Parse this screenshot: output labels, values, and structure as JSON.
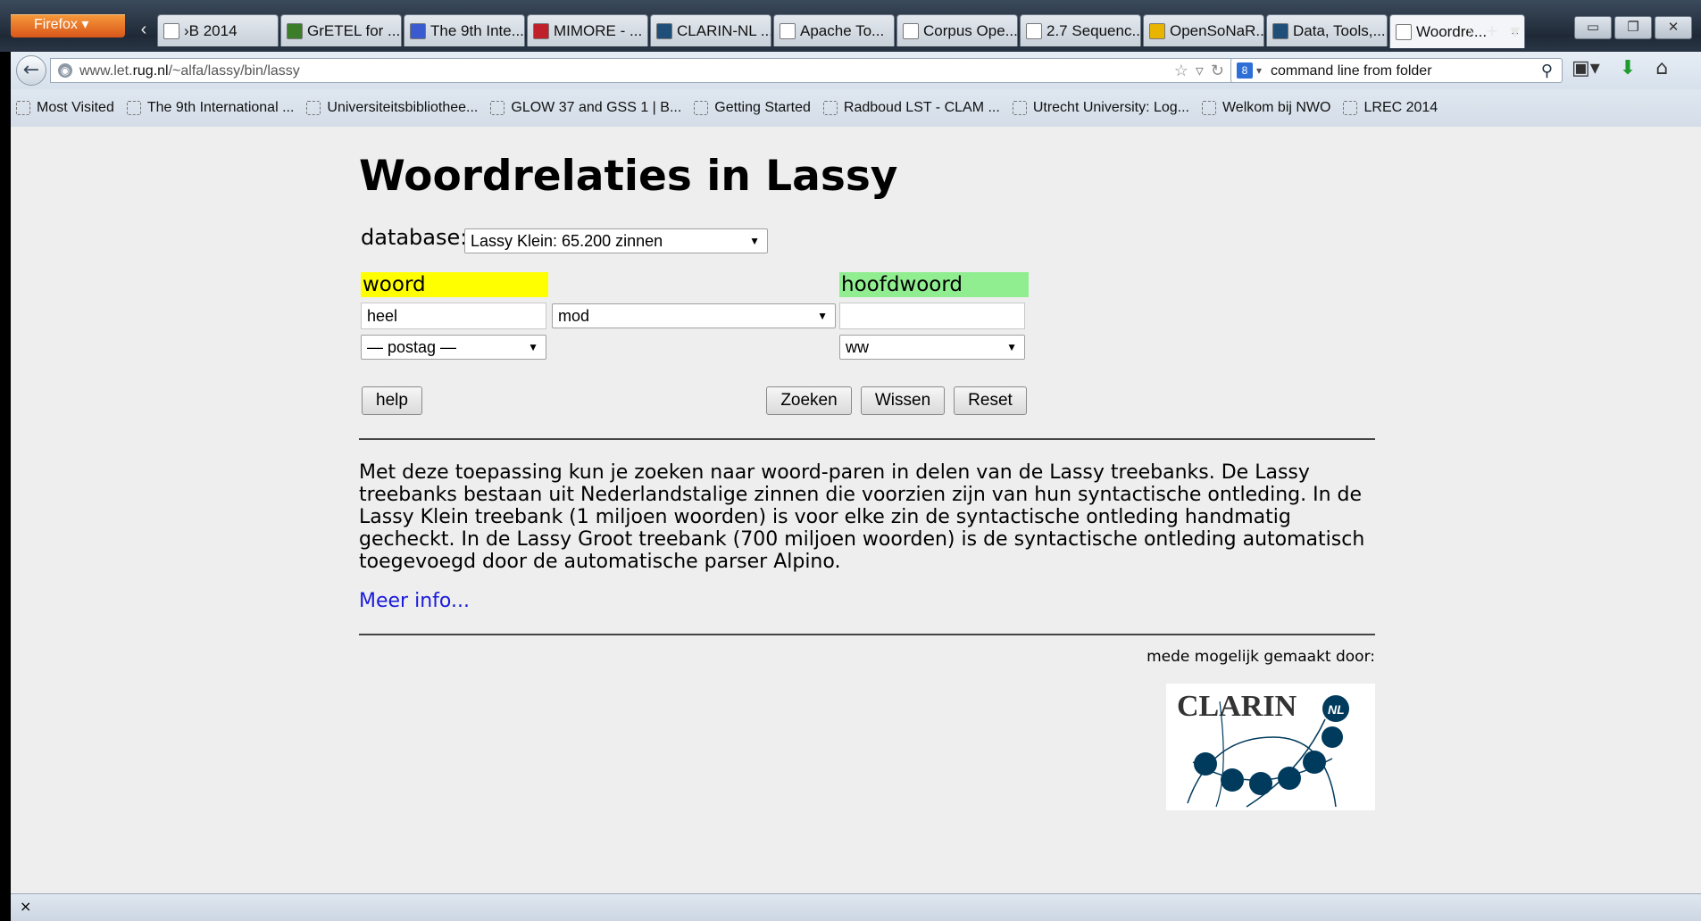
{
  "browser": {
    "menu_label": "Firefox",
    "tabs": [
      {
        "label": "›B 2014",
        "icon": "page-icon"
      },
      {
        "label": "GrETEL for ...",
        "icon": "tree-icon"
      },
      {
        "label": "The 9th Inte...",
        "icon": "s-logo-icon"
      },
      {
        "label": "MIMORE - ...",
        "icon": "bars-icon"
      },
      {
        "label": "CLARIN-NL ...",
        "icon": "clarin-icon"
      },
      {
        "label": "Apache To...",
        "icon": "page-icon"
      },
      {
        "label": "Corpus Ope...",
        "icon": "page-icon"
      },
      {
        "label": "2.7 Sequenc...",
        "icon": "page-icon"
      },
      {
        "label": "OpenSoNaR...",
        "icon": "sun-icon"
      },
      {
        "label": "Data, Tools,...",
        "icon": "clarin-icon"
      },
      {
        "label": "Woordre...",
        "icon": "page-icon",
        "active": true
      }
    ],
    "tab_close": "×",
    "url_domain": "www.let.",
    "url_host": "rug.nl",
    "url_path": "/~alfa/lassy/bin/lassy",
    "search_value": "command line from folder",
    "bookmarks": [
      {
        "label": "Most Visited"
      },
      {
        "label": "The 9th International ..."
      },
      {
        "label": "Universiteitsbibliothee..."
      },
      {
        "label": "GLOW 37 and GSS 1 | B..."
      },
      {
        "label": "Getting Started"
      },
      {
        "label": "Radboud LST - CLAM ..."
      },
      {
        "label": "Utrecht University: Log..."
      },
      {
        "label": "Welkom bij NWO"
      },
      {
        "label": "LREC 2014"
      }
    ],
    "status_text": "×"
  },
  "page": {
    "title": "Woordrelaties in Lassy",
    "database_label": "database:",
    "database_value": "Lassy Klein: 65.200 zinnen",
    "woord_label": "woord",
    "hoofdwoord_label": "hoofdwoord",
    "woord_value": "heel",
    "relation_value": "mod",
    "hoofdwoord_value": "",
    "woord_postag": "— postag —",
    "hoofdwoord_postag": "ww",
    "buttons": {
      "help": "help",
      "search": "Zoeken",
      "clear": "Wissen",
      "reset": "Reset"
    },
    "description": "Met deze toepassing kun je zoeken naar woord-paren in delen van de Lassy treebanks. De Lassy treebanks bestaan uit Nederlandstalige zinnen die voorzien zijn van hun syntactische ontleding. In de Lassy Klein treebank (1 miljoen woorden) is voor elke zin de syntactische ontleding handmatig gecheckt. In de Lassy Groot treebank (700 miljoen woorden) is de syntactische ontleding automatisch toegevoegd door de automatische parser Alpino.",
    "more_info": "Meer info...",
    "credit": "mede mogelijk gemaakt door:",
    "logo_text": "CLARIN",
    "logo_badge": "NL"
  },
  "colors": {
    "woord_bg": "#ffff00",
    "hoofdwoord_bg": "#90ee90",
    "link": "#1a1adb"
  }
}
